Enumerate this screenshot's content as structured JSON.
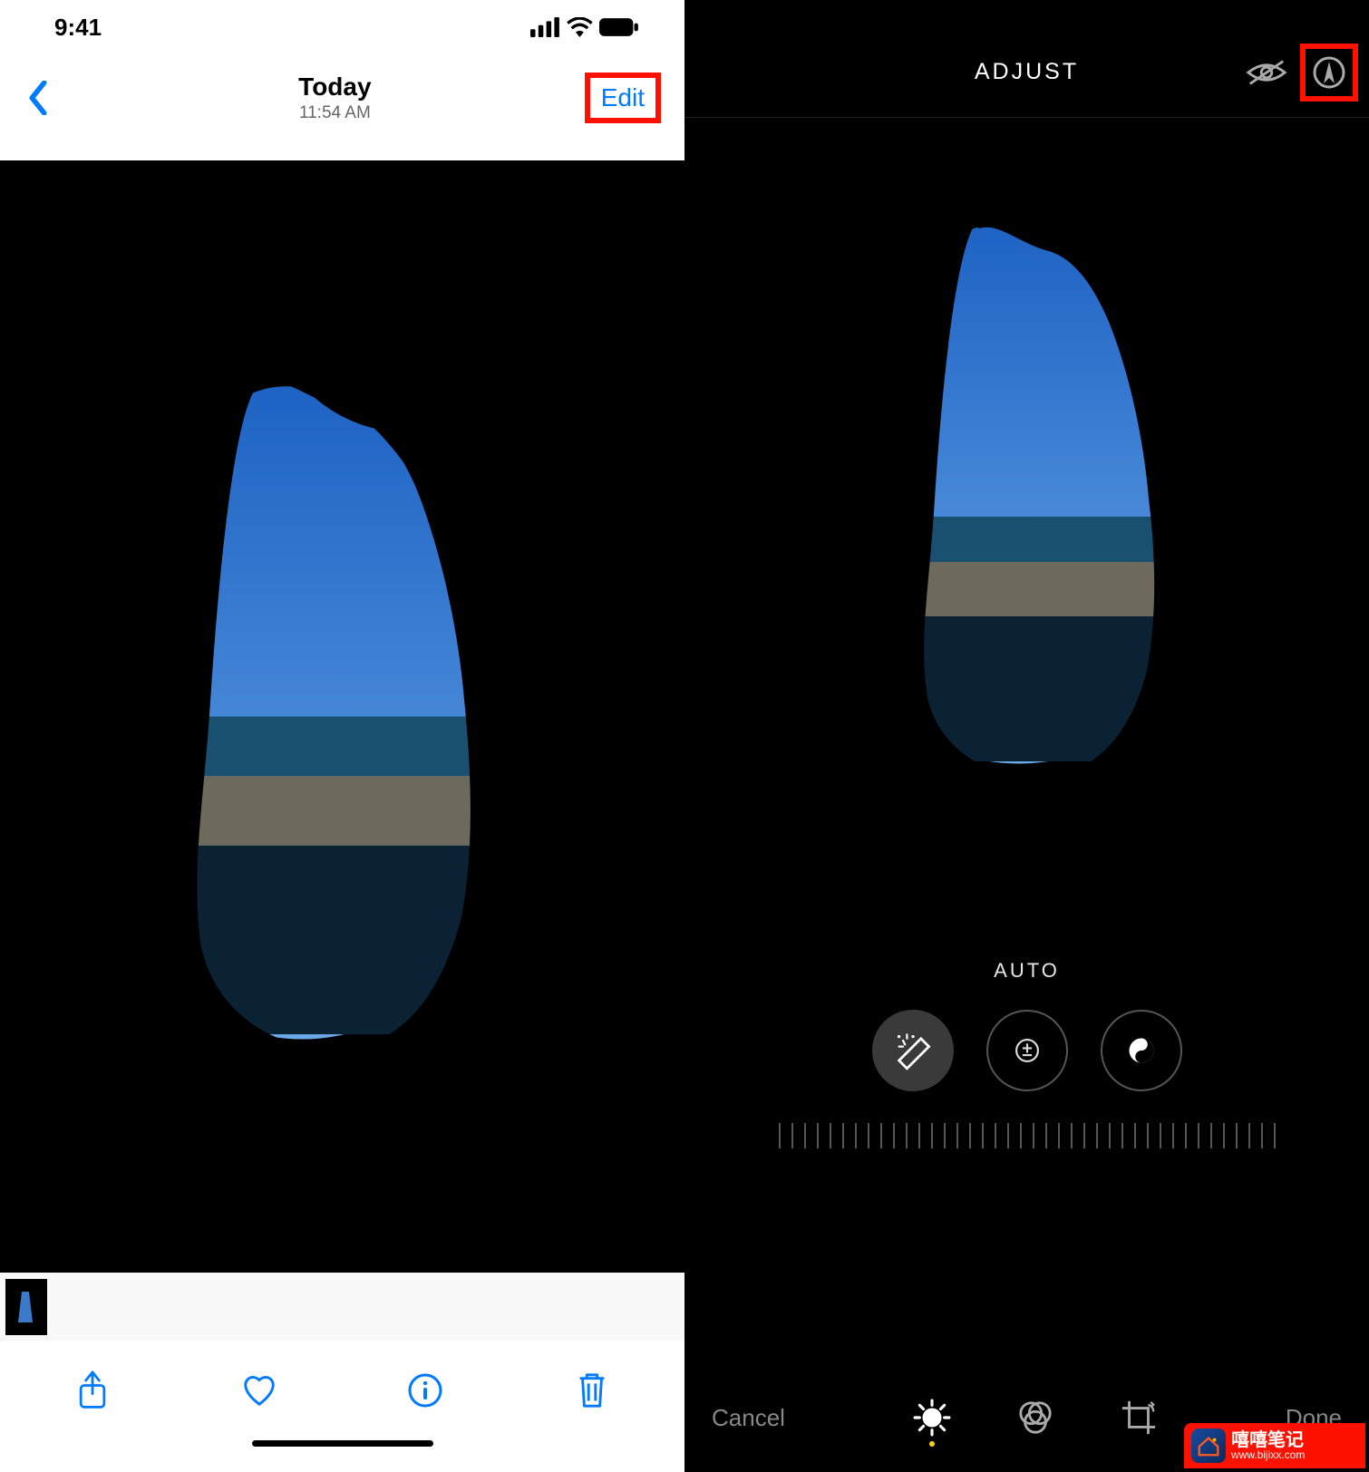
{
  "left": {
    "status": {
      "time": "9:41"
    },
    "nav": {
      "title": "Today",
      "subtitle": "11:54 AM",
      "edit": "Edit"
    }
  },
  "right": {
    "header": {
      "title": "ADJUST"
    },
    "auto_label": "AUTO",
    "footer": {
      "cancel": "Cancel",
      "done": "Done"
    }
  },
  "watermark": {
    "line1": "嘻嘻笔记",
    "line2": "www.bijixx.com"
  }
}
